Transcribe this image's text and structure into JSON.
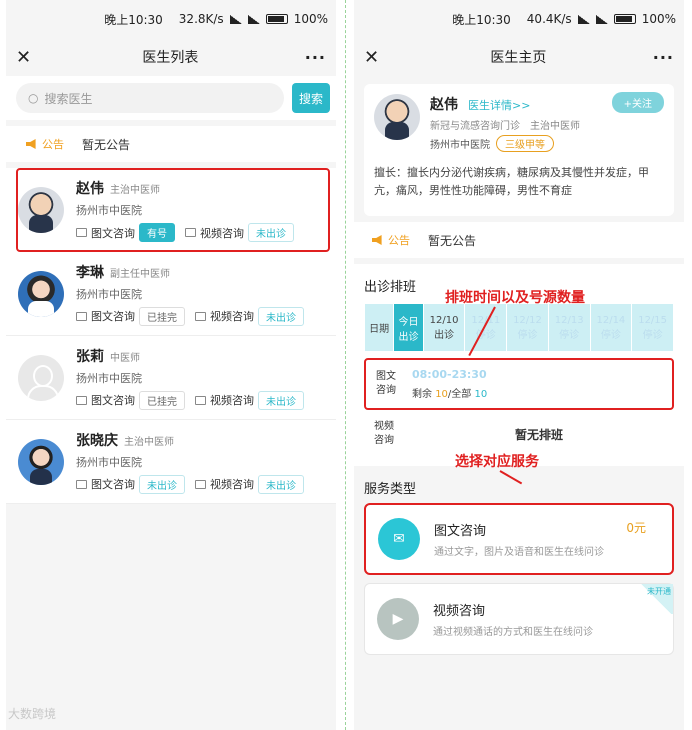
{
  "status": {
    "time": "晚上10:30",
    "speed_left": "32.8K/s",
    "speed_right": "40.4K/s",
    "battery": "100%"
  },
  "left": {
    "nav_title": "医生列表",
    "search_placeholder": "搜索医生",
    "search_btn": "搜索",
    "notice_tag": "公告",
    "notice_text": "暂无公告",
    "doctors": [
      {
        "name": "赵伟",
        "title": "主治中医师",
        "hospital": "扬州市中医院",
        "img_label": "图文咨询",
        "img_status": "有号",
        "video_label": "视频咨询",
        "video_status": "未出诊"
      },
      {
        "name": "李琳",
        "title": "副主任中医师",
        "hospital": "扬州市中医院",
        "img_label": "图文咨询",
        "img_status": "已挂完",
        "video_label": "视频咨询",
        "video_status": "未出诊"
      },
      {
        "name": "张莉",
        "title": "中医师",
        "hospital": "扬州市中医院",
        "img_label": "图文咨询",
        "img_status": "已挂完",
        "video_label": "视频咨询",
        "video_status": "未出诊"
      },
      {
        "name": "张晓庆",
        "title": "主治中医师",
        "hospital": "扬州市中医院",
        "img_label": "图文咨询",
        "img_status": "未出诊",
        "video_label": "视频咨询",
        "video_status": "未出诊"
      }
    ]
  },
  "right": {
    "nav_title": "医生主页",
    "doctor": {
      "name": "赵伟",
      "detail_link": "医生详情>>",
      "follow": "+关注",
      "dept": "新冠与流感咨询门诊",
      "title": "主治中医师",
      "hospital": "扬州市中医院",
      "grade": "三级甲等",
      "specialty": "擅长：擅长内分泌代谢疾病，糖尿病及其慢性并发症，甲亢，痛风，男性性功能障碍，男性不育症"
    },
    "notice_tag": "公告",
    "notice_text": "暂无公告",
    "schedule_title": "出诊排班",
    "schedule_header": [
      "日期",
      "今日\n出诊",
      "12/10\n出诊",
      "12/11\n停诊",
      "12/12\n停诊",
      "12/13\n停诊",
      "12/14\n停诊",
      "12/15\n停诊"
    ],
    "slot_label_1": "图文",
    "slot_label_2": "咨询",
    "slot_time": "08:00-23:30",
    "remain_label": "剩余",
    "remain": "10",
    "total_label": "/全部",
    "total": "10",
    "video_label_1": "视频",
    "video_label_2": "咨询",
    "no_schedule": "暂无排班",
    "service_title": "服务类型",
    "services": [
      {
        "name": "图文咨询",
        "desc": "通过文字，图片及语音和医生在线问诊",
        "price": "0元"
      },
      {
        "name": "视频咨询",
        "desc": "通过视频通话的方式和医生在线问诊",
        "ribbon": "未开通"
      }
    ],
    "anno_schedule": "排班时间以及号源数量",
    "anno_service": "选择对应服务"
  },
  "watermark": "大数跨境"
}
